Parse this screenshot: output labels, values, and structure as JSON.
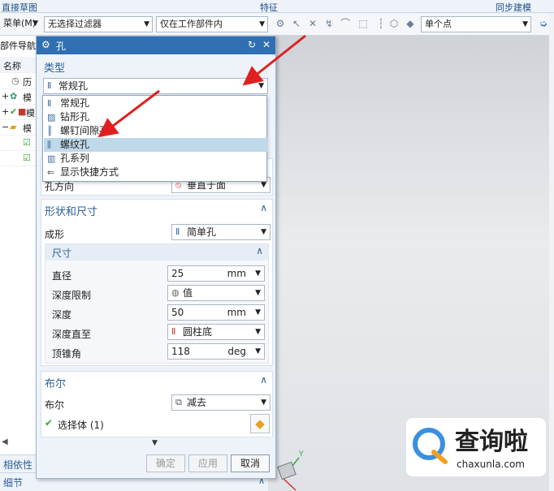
{
  "topbar": {
    "left": "直接草图",
    "center": "特征",
    "right": "同步建模"
  },
  "toolbar": {
    "menu_label": "菜单(M)",
    "filter_value": "无选择过滤器",
    "scope_value": "仅在工作部件内",
    "snap_value": "单个点"
  },
  "navigator": {
    "title": "部件导航",
    "column_name": "名称",
    "rows": [
      {
        "label": "历"
      },
      {
        "label": "模"
      },
      {
        "label": "模"
      },
      {
        "label": "模"
      }
    ],
    "section_dependency": "相依性",
    "section_detail": "细节"
  },
  "dialog": {
    "title": "孔",
    "type_section": {
      "title": "类型",
      "selected": "常规孔",
      "options": [
        "常规孔",
        "钻形孔",
        "螺钉间隙孔",
        "螺纹孔",
        "孔系列",
        "显示快捷方式"
      ],
      "highlighted_index": 3
    },
    "direction": {
      "label": "孔方向",
      "value": "垂直于面"
    },
    "shape_section": {
      "title": "形状和尺寸",
      "form_label": "成形",
      "form_value": "简单孔",
      "dims_title": "尺寸",
      "diameter_label": "直径",
      "diameter_value": "25",
      "diameter_unit": "mm",
      "depth_limit_label": "深度限制",
      "depth_limit_value": "值",
      "depth_label": "深度",
      "depth_value": "50",
      "depth_unit": "mm",
      "depth_to_label": "深度直至",
      "depth_to_value": "圆柱底",
      "tip_label": "顶锥角",
      "tip_value": "118",
      "tip_unit": "deg"
    },
    "boolean_section": {
      "title": "布尔",
      "label": "布尔",
      "value": "减去",
      "select_body": "选择体 (1)"
    },
    "buttons": {
      "ok": "确定",
      "apply": "应用",
      "cancel": "取消"
    }
  },
  "watermark": {
    "brand": "查询啦",
    "domain": "chaxunla.com"
  },
  "colors": {
    "title_bar": "#2f6fb2",
    "section_text": "#2a5f98",
    "highlight": "#bfd8ea",
    "arrow": "#e02020",
    "check": "#3aa53a"
  }
}
